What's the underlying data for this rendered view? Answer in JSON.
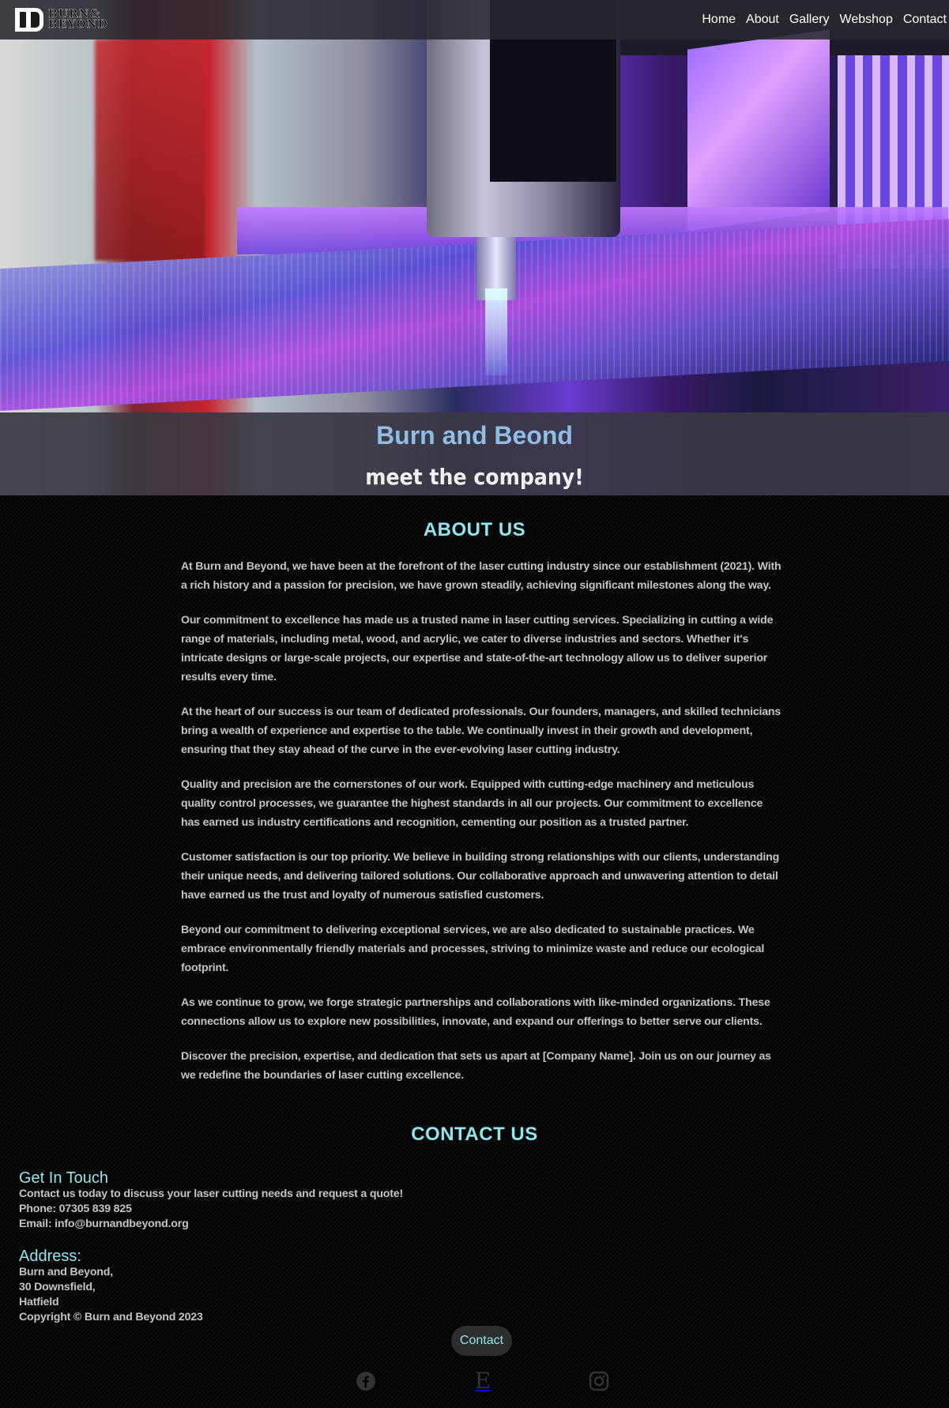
{
  "brand": {
    "logo_line1": "BURN&",
    "logo_line2": "BEYOND"
  },
  "nav": {
    "items": [
      {
        "label": "Home"
      },
      {
        "label": "About"
      },
      {
        "label": "Gallery"
      },
      {
        "label": "Webshop"
      },
      {
        "label": "Contact"
      }
    ]
  },
  "hero": {
    "title": "Burn and Beond",
    "subtitle": "meet the company!"
  },
  "about": {
    "heading": "ABOUT US",
    "paragraphs": [
      "At Burn and Beyond, we have been at the forefront of the laser cutting industry since our establishment (2021). With a rich history and a passion for precision, we have grown steadily, achieving significant milestones along the way.",
      "Our commitment to excellence has made us a trusted name in laser cutting services. Specializing in cutting a wide range of materials, including metal, wood, and acrylic, we cater to diverse industries and sectors. Whether it's intricate designs or large-scale projects, our expertise and state-of-the-art technology allow us to deliver superior results every time.",
      "At the heart of our success is our team of dedicated professionals. Our founders, managers, and skilled technicians bring a wealth of experience and expertise to the table. We continually invest in their growth and development, ensuring that they stay ahead of the curve in the ever-evolving laser cutting industry.",
      "Quality and precision are the cornerstones of our work. Equipped with cutting-edge machinery and meticulous quality control processes, we guarantee the highest standards in all our projects. Our commitment to excellence has earned us industry certifications and recognition, cementing our position as a trusted partner.",
      "Customer satisfaction is our top priority. We believe in building strong relationships with our clients, understanding their unique needs, and delivering tailored solutions. Our collaborative approach and unwavering attention to detail have earned us the trust and loyalty of numerous satisfied customers.",
      "Beyond our commitment to delivering exceptional services, we are also dedicated to sustainable practices. We embrace environmentally friendly materials and processes, striving to minimize waste and reduce our ecological footprint.",
      "As we continue to grow, we forge strategic partnerships and collaborations with like-minded organizations. These connections allow us to explore new possibilities, innovate, and expand our offerings to better serve our clients.",
      "Discover the precision, expertise, and dedication that sets us apart at [Company Name]. Join us on our journey as we redefine the boundaries of laser cutting excellence."
    ]
  },
  "contact": {
    "heading": "CONTACT US",
    "get_in_touch": {
      "title": "Get In Touch",
      "text": "Contact us today to discuss your laser cutting needs and request a quote!",
      "phone": "Phone: 07305 839 825",
      "email": "Email: info@burnandbeyond.org"
    },
    "address": {
      "title": "Address:",
      "line1": "Burn and Beyond,",
      "line2": "30 Downsfield,",
      "line3": "Hatfield"
    },
    "copyright": "Copyright © Burn and Beyond 2023",
    "button_label": "Contact"
  },
  "social": {
    "icons": [
      "facebook-icon",
      "etsy-icon",
      "instagram-icon"
    ],
    "etsy_glyph": "E"
  },
  "colors": {
    "accent": "#8fe6ef",
    "title": "#8fbde6",
    "body_text": "#c4c4c4",
    "nav_bg": "#28282f"
  }
}
